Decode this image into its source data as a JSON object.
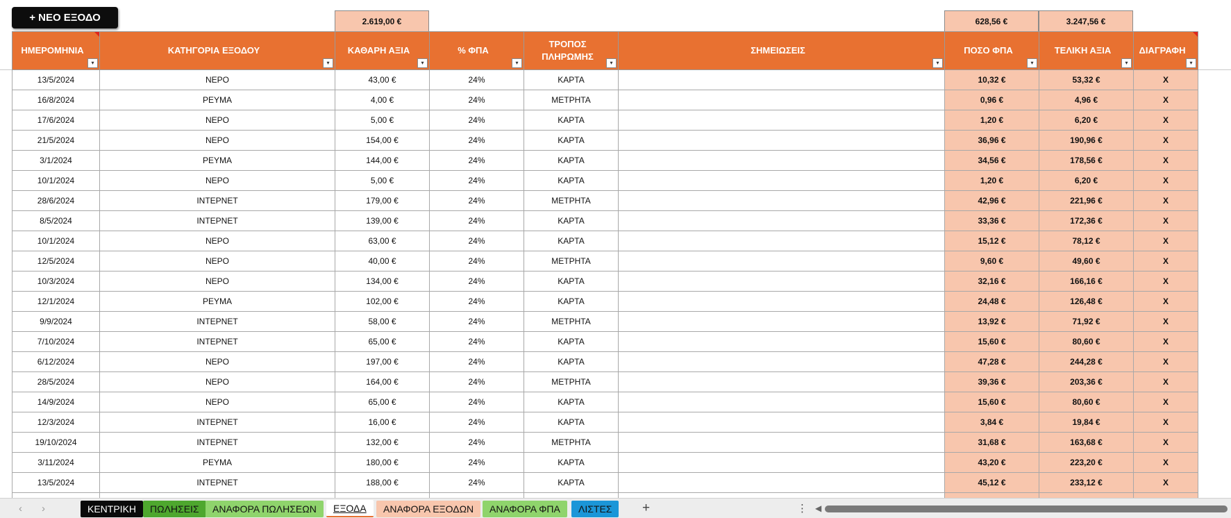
{
  "toolbar": {
    "new_expense_label": "+ ΝΕΟ ΕΞΟΔΟ"
  },
  "totals": {
    "net": "2.619,00 €",
    "vat": "628,56 €",
    "final": "3.247,56 €"
  },
  "columns": [
    "ΗΜΕΡΟΜΗΝΙΑ",
    "ΚΑΤΗΓΟΡΙΑ ΕΞΟΔΟΥ",
    "ΚΑΘΑΡΗ ΑΞΙΑ",
    "% ΦΠΑ",
    "ΤΡΟΠΟΣ ΠΛΗΡΩΜΗΣ",
    "ΣΗΜΕΙΩΣΕΙΣ",
    "ΠΟΣΟ ΦΠΑ",
    "ΤΕΛΙΚΗ ΑΞΙΑ",
    "ΔΙΑΓΡΑΦΗ"
  ],
  "rows": [
    [
      "13/5/2024",
      "ΝΕΡΟ",
      "43,00 €",
      "24%",
      "ΚΑΡΤΑ",
      "",
      "10,32 €",
      "53,32 €",
      "X"
    ],
    [
      "16/8/2024",
      "ΡΕΥΜΑ",
      "4,00 €",
      "24%",
      "ΜΕΤΡΗΤΑ",
      "",
      "0,96 €",
      "4,96 €",
      "X"
    ],
    [
      "17/6/2024",
      "ΝΕΡΟ",
      "5,00 €",
      "24%",
      "ΚΑΡΤΑ",
      "",
      "1,20 €",
      "6,20 €",
      "X"
    ],
    [
      "21/5/2024",
      "ΝΕΡΟ",
      "154,00 €",
      "24%",
      "ΚΑΡΤΑ",
      "",
      "36,96 €",
      "190,96 €",
      "X"
    ],
    [
      "3/1/2024",
      "ΡΕΥΜΑ",
      "144,00 €",
      "24%",
      "ΚΑΡΤΑ",
      "",
      "34,56 €",
      "178,56 €",
      "X"
    ],
    [
      "10/1/2024",
      "ΝΕΡΟ",
      "5,00 €",
      "24%",
      "ΚΑΡΤΑ",
      "",
      "1,20 €",
      "6,20 €",
      "X"
    ],
    [
      "28/6/2024",
      "ΙΝΤΕΡΝΕΤ",
      "179,00 €",
      "24%",
      "ΜΕΤΡΗΤΑ",
      "",
      "42,96 €",
      "221,96 €",
      "X"
    ],
    [
      "8/5/2024",
      "ΙΝΤΕΡΝΕΤ",
      "139,00 €",
      "24%",
      "ΚΑΡΤΑ",
      "",
      "33,36 €",
      "172,36 €",
      "X"
    ],
    [
      "10/1/2024",
      "ΝΕΡΟ",
      "63,00 €",
      "24%",
      "ΚΑΡΤΑ",
      "",
      "15,12 €",
      "78,12 €",
      "X"
    ],
    [
      "12/5/2024",
      "ΝΕΡΟ",
      "40,00 €",
      "24%",
      "ΜΕΤΡΗΤΑ",
      "",
      "9,60 €",
      "49,60 €",
      "X"
    ],
    [
      "10/3/2024",
      "ΝΕΡΟ",
      "134,00 €",
      "24%",
      "ΚΑΡΤΑ",
      "",
      "32,16 €",
      "166,16 €",
      "X"
    ],
    [
      "12/1/2024",
      "ΡΕΥΜΑ",
      "102,00 €",
      "24%",
      "ΚΑΡΤΑ",
      "",
      "24,48 €",
      "126,48 €",
      "X"
    ],
    [
      "9/9/2024",
      "ΙΝΤΕΡΝΕΤ",
      "58,00 €",
      "24%",
      "ΜΕΤΡΗΤΑ",
      "",
      "13,92 €",
      "71,92 €",
      "X"
    ],
    [
      "7/10/2024",
      "ΙΝΤΕΡΝΕΤ",
      "65,00 €",
      "24%",
      "ΚΑΡΤΑ",
      "",
      "15,60 €",
      "80,60 €",
      "X"
    ],
    [
      "6/12/2024",
      "ΝΕΡΟ",
      "197,00 €",
      "24%",
      "ΚΑΡΤΑ",
      "",
      "47,28 €",
      "244,28 €",
      "X"
    ],
    [
      "28/5/2024",
      "ΝΕΡΟ",
      "164,00 €",
      "24%",
      "ΜΕΤΡΗΤΑ",
      "",
      "39,36 €",
      "203,36 €",
      "X"
    ],
    [
      "14/9/2024",
      "ΝΕΡΟ",
      "65,00 €",
      "24%",
      "ΚΑΡΤΑ",
      "",
      "15,60 €",
      "80,60 €",
      "X"
    ],
    [
      "12/3/2024",
      "ΙΝΤΕΡΝΕΤ",
      "16,00 €",
      "24%",
      "ΚΑΡΤΑ",
      "",
      "3,84 €",
      "19,84 €",
      "X"
    ],
    [
      "19/10/2024",
      "ΙΝΤΕΡΝΕΤ",
      "132,00 €",
      "24%",
      "ΜΕΤΡΗΤΑ",
      "",
      "31,68 €",
      "163,68 €",
      "X"
    ],
    [
      "3/11/2024",
      "ΡΕΥΜΑ",
      "180,00 €",
      "24%",
      "ΚΑΡΤΑ",
      "",
      "43,20 €",
      "223,20 €",
      "X"
    ],
    [
      "13/5/2024",
      "ΙΝΤΕΡΝΕΤ",
      "188,00 €",
      "24%",
      "ΚΑΡΤΑ",
      "",
      "45,12 €",
      "233,12 €",
      "X"
    ]
  ],
  "sheet_tabs": [
    {
      "label": "ΚΕΝΤΡΙΚΗ",
      "bg": "#0a0a0a",
      "fg": "#ffffff",
      "active": false
    },
    {
      "label": "ΠΩΛΗΣΕΙΣ",
      "bg": "#4ea72e",
      "fg": "#111111",
      "active": false
    },
    {
      "label": "ΑΝΑΦΟΡΑ ΠΩΛΗΣΕΩΝ",
      "bg": "#8fd46c",
      "fg": "#111111",
      "active": false
    },
    {
      "label": "ΕΞΟΔΑ",
      "bg": "#ffffff",
      "fg": "#111111",
      "active": true
    },
    {
      "label": "ΑΝΑΦΟΡΑ ΕΞΟΔΩΝ",
      "bg": "#f8c6ad",
      "fg": "#111111",
      "active": false
    },
    {
      "label": "ΑΝΑΦΟΡΑ ΦΠΑ",
      "bg": "#8fd46c",
      "fg": "#111111",
      "active": false
    },
    {
      "label": "ΛΙΣΤΕΣ",
      "bg": "#1b96d8",
      "fg": "#111111",
      "active": false
    }
  ],
  "colors": {
    "header": "#e87131",
    "peach": "#f8c6ad",
    "accent_corner": "#e0251b"
  },
  "icons": {
    "filter": "▾",
    "prev": "‹",
    "next": "›",
    "add": "+",
    "more": "⋮",
    "scroll_left": "◀"
  }
}
